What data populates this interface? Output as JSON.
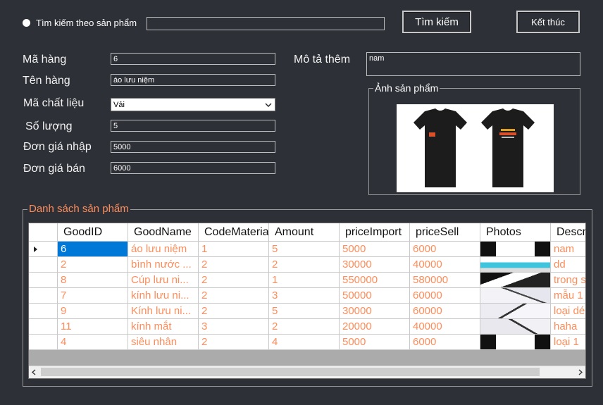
{
  "search": {
    "radio_label": "Tìm kiếm theo sản phẩm",
    "input_value": "",
    "search_button": "Tìm kiếm",
    "exit_button": "Kết thúc"
  },
  "form": {
    "ma_hang_label": "Mã hàng",
    "ma_hang_value": "6",
    "ten_hang_label": "Tên hàng",
    "ten_hang_value": "áo lưu niệm",
    "ma_chat_lieu_label": "Mã chất liệu",
    "ma_chat_lieu_value": "Vải",
    "so_luong_label": "Số lượng",
    "so_luong_value": "5",
    "don_gia_nhap_label": "Đơn giá nhập",
    "don_gia_nhap_value": "5000",
    "don_gia_ban_label": "Đơn giá bán",
    "don_gia_ban_value": "6000",
    "mo_ta_label": "Mô tả thêm",
    "mo_ta_value": "nam",
    "anh_group_title": "Ảnh sản phẩm"
  },
  "grid": {
    "group_title": "Danh sách sản phẩm",
    "columns": [
      "GoodID",
      "GoodName",
      "CodeMateria",
      "Amount",
      "priceImport",
      "priceSell",
      "Photos",
      "Descr"
    ],
    "rows": [
      [
        "6",
        "áo lưu niệm",
        "1",
        "5",
        "5000",
        "6000",
        "",
        "nam"
      ],
      [
        "2",
        "bình nước ...",
        "2",
        "2",
        "30000",
        "40000",
        "",
        "dd"
      ],
      [
        "8",
        "Cúp lưu ni...",
        "2",
        "1",
        "550000",
        "580000",
        "",
        "trong s"
      ],
      [
        "7",
        "kính lưu ni...",
        "2",
        "3",
        "50000",
        "60000",
        "",
        "mẫu 1"
      ],
      [
        "9",
        "Kính lưu ni...",
        "2",
        "5",
        "30000",
        "60000",
        "",
        "loại dé"
      ],
      [
        "11",
        "kính mắt",
        "3",
        "2",
        "20000",
        "40000",
        "",
        "haha"
      ],
      [
        "4",
        "siêu nhân",
        "2",
        "4",
        "5000",
        "6000",
        "",
        "loại 1"
      ]
    ]
  },
  "colors": {
    "background": "#2d3036",
    "accent_orange": "#ff8c5a",
    "selection_blue": "#0078d7"
  },
  "icons": [
    "radio-icon",
    "chevron-down-icon",
    "row-pointer-icon",
    "scroll-left-icon",
    "scroll-right-icon"
  ]
}
